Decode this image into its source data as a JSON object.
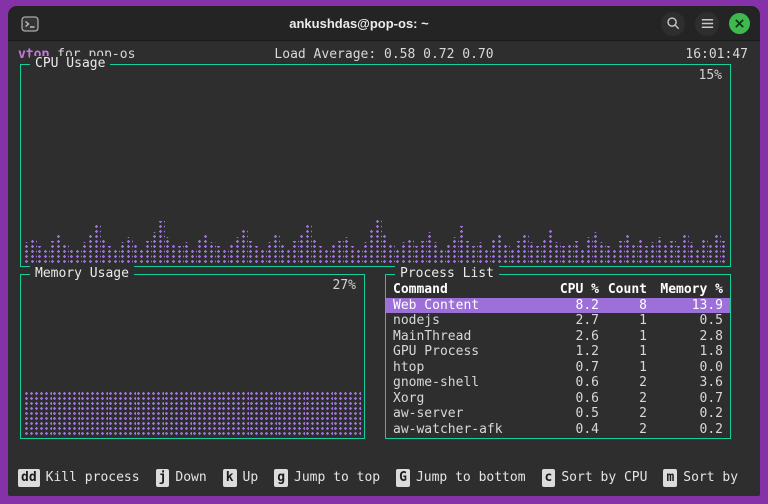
{
  "window": {
    "title": "ankushdas@pop-os: ~"
  },
  "statusline": {
    "app": "vtop",
    "app_suffix": " for pop-os",
    "load": "Load Average: 0.58 0.72 0.70",
    "time": "16:01:47"
  },
  "cpu": {
    "title": "CPU Usage",
    "percent": "15%",
    "history": [
      12,
      14,
      10,
      9,
      13,
      17,
      11,
      9,
      8,
      12,
      16,
      22,
      14,
      10,
      9,
      12,
      15,
      11,
      9,
      13,
      18,
      24,
      15,
      11,
      10,
      12,
      9,
      14,
      17,
      12,
      10,
      8,
      11,
      15,
      20,
      13,
      10,
      9,
      12,
      16,
      11,
      9,
      13,
      17,
      22,
      14,
      10,
      9,
      11,
      13,
      15,
      10,
      8,
      12,
      19,
      25,
      16,
      11,
      9,
      12,
      14,
      10,
      13,
      18,
      12,
      9,
      11,
      15,
      21,
      13,
      10,
      12,
      9,
      14,
      17,
      11,
      9,
      13,
      16,
      12,
      10,
      14,
      19,
      12,
      10,
      11,
      13,
      9,
      15,
      18,
      12,
      10,
      9,
      13,
      16,
      11,
      14,
      10,
      12,
      15,
      11,
      13,
      10,
      16,
      12,
      9,
      14,
      11,
      17,
      13
    ]
  },
  "memory": {
    "title": "Memory Usage",
    "percent": "27%",
    "history": [
      27,
      27,
      27,
      27,
      27,
      27,
      27,
      27,
      27,
      27,
      27,
      27
    ]
  },
  "process_list": {
    "title": "Process List",
    "columns": [
      "Command",
      "CPU %",
      "Count",
      "Memory %"
    ],
    "rows": [
      {
        "command": "Web Content",
        "cpu": "8.2",
        "count": "8",
        "memory": "13.9",
        "selected": true
      },
      {
        "command": "nodejs",
        "cpu": "2.7",
        "count": "1",
        "memory": "0.5"
      },
      {
        "command": "MainThread",
        "cpu": "2.6",
        "count": "1",
        "memory": "2.8"
      },
      {
        "command": "GPU Process",
        "cpu": "1.2",
        "count": "1",
        "memory": "1.8"
      },
      {
        "command": "htop",
        "cpu": "0.7",
        "count": "1",
        "memory": "0.0"
      },
      {
        "command": "gnome-shell",
        "cpu": "0.6",
        "count": "2",
        "memory": "3.6"
      },
      {
        "command": "Xorg",
        "cpu": "0.6",
        "count": "2",
        "memory": "0.7"
      },
      {
        "command": "aw-server",
        "cpu": "0.5",
        "count": "2",
        "memory": "0.2"
      },
      {
        "command": "aw-watcher-afk",
        "cpu": "0.4",
        "count": "2",
        "memory": "0.2"
      }
    ]
  },
  "keybinds": [
    {
      "key": "dd",
      "label": "Kill process"
    },
    {
      "key": "j",
      "label": "Down"
    },
    {
      "key": "k",
      "label": "Up"
    },
    {
      "key": "g",
      "label": "Jump to top"
    },
    {
      "key": "G",
      "label": "Jump to bottom"
    },
    {
      "key": "c",
      "label": "Sort by CPU"
    },
    {
      "key": "m",
      "label": "Sort by"
    }
  ],
  "colors": {
    "frame": "#8531a8",
    "terminal_bg": "#2e2e2e",
    "box_border": "#15cf9e",
    "chart_dot": "#9e72d9",
    "selected_bg": "#9c70d8",
    "app_name": "#c678dd",
    "close_button": "#3fb94f"
  }
}
